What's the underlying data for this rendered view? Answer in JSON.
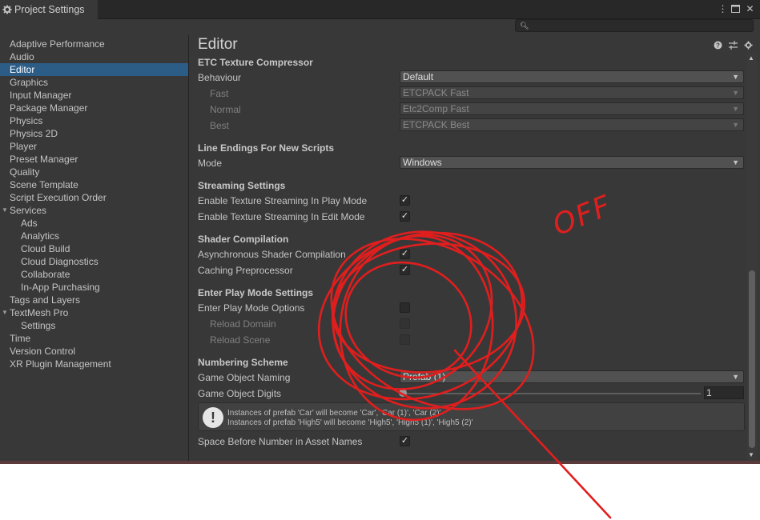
{
  "window": {
    "tab_title": "Project Settings",
    "menu_icon": "kebab-menu-icon",
    "maximize_icon": "maximize-icon",
    "close_icon": "close-icon",
    "search_placeholder": ""
  },
  "sidebar": {
    "items": [
      {
        "label": "Adaptive Performance",
        "indent": 0
      },
      {
        "label": "Audio",
        "indent": 0
      },
      {
        "label": "Editor",
        "indent": 0,
        "selected": true
      },
      {
        "label": "Graphics",
        "indent": 0
      },
      {
        "label": "Input Manager",
        "indent": 0
      },
      {
        "label": "Package Manager",
        "indent": 0
      },
      {
        "label": "Physics",
        "indent": 0
      },
      {
        "label": "Physics 2D",
        "indent": 0
      },
      {
        "label": "Player",
        "indent": 0
      },
      {
        "label": "Preset Manager",
        "indent": 0
      },
      {
        "label": "Quality",
        "indent": 0
      },
      {
        "label": "Scene Template",
        "indent": 0
      },
      {
        "label": "Script Execution Order",
        "indent": 0
      },
      {
        "label": "Services",
        "indent": 0,
        "expanded": true
      },
      {
        "label": "Ads",
        "indent": 1
      },
      {
        "label": "Analytics",
        "indent": 1
      },
      {
        "label": "Cloud Build",
        "indent": 1
      },
      {
        "label": "Cloud Diagnostics",
        "indent": 1
      },
      {
        "label": "Collaborate",
        "indent": 1
      },
      {
        "label": "In-App Purchasing",
        "indent": 1
      },
      {
        "label": "Tags and Layers",
        "indent": 0
      },
      {
        "label": "TextMesh Pro",
        "indent": 0,
        "expanded": true
      },
      {
        "label": "Settings",
        "indent": 1
      },
      {
        "label": "Time",
        "indent": 0
      },
      {
        "label": "Version Control",
        "indent": 0
      },
      {
        "label": "XR Plugin Management",
        "indent": 0
      }
    ]
  },
  "main": {
    "title": "Editor",
    "header_icons": [
      "help-icon",
      "preset-icon",
      "settings-gear-icon"
    ],
    "etc": {
      "section": "ETC Texture Compressor",
      "behaviour_label": "Behaviour",
      "behaviour_value": "Default",
      "fast_label": "Fast",
      "fast_value": "ETCPACK Fast",
      "normal_label": "Normal",
      "normal_value": "Etc2Comp Fast",
      "best_label": "Best",
      "best_value": "ETCPACK Best"
    },
    "line_endings": {
      "section": "Line Endings For New Scripts",
      "mode_label": "Mode",
      "mode_value": "Windows"
    },
    "streaming": {
      "section": "Streaming Settings",
      "play_label": "Enable Texture Streaming In Play Mode",
      "play_checked": true,
      "edit_label": "Enable Texture Streaming In Edit Mode",
      "edit_checked": true
    },
    "shader": {
      "section": "Shader Compilation",
      "async_label": "Asynchronous Shader Compilation",
      "async_checked": true,
      "caching_label": "Caching Preprocessor",
      "caching_checked": true
    },
    "play_mode": {
      "section": "Enter Play Mode Settings",
      "options_label": "Enter Play Mode Options",
      "options_checked": false,
      "reload_domain_label": "Reload Domain",
      "reload_domain_checked": false,
      "reload_scene_label": "Reload Scene",
      "reload_scene_checked": false
    },
    "numbering": {
      "section": "Numbering Scheme",
      "naming_label": "Game Object Naming",
      "naming_value": "Prefab (1)",
      "digits_label": "Game Object Digits",
      "digits_value": "1",
      "help_line1": "Instances of prefab 'Car' will become 'Car', 'Car (1)', 'Car (2)'",
      "help_line2": "Instances of prefab 'High5' will become 'High5', 'High5 (1)', 'High5 (2)'",
      "space_label": "Space Before Number in Asset Names",
      "space_checked": true
    }
  },
  "annotation": {
    "text": "OFF",
    "color": "#e11e1e"
  },
  "colors": {
    "selection": "#2c5d87",
    "panel": "#383838",
    "annotation": "#e11e1e"
  }
}
